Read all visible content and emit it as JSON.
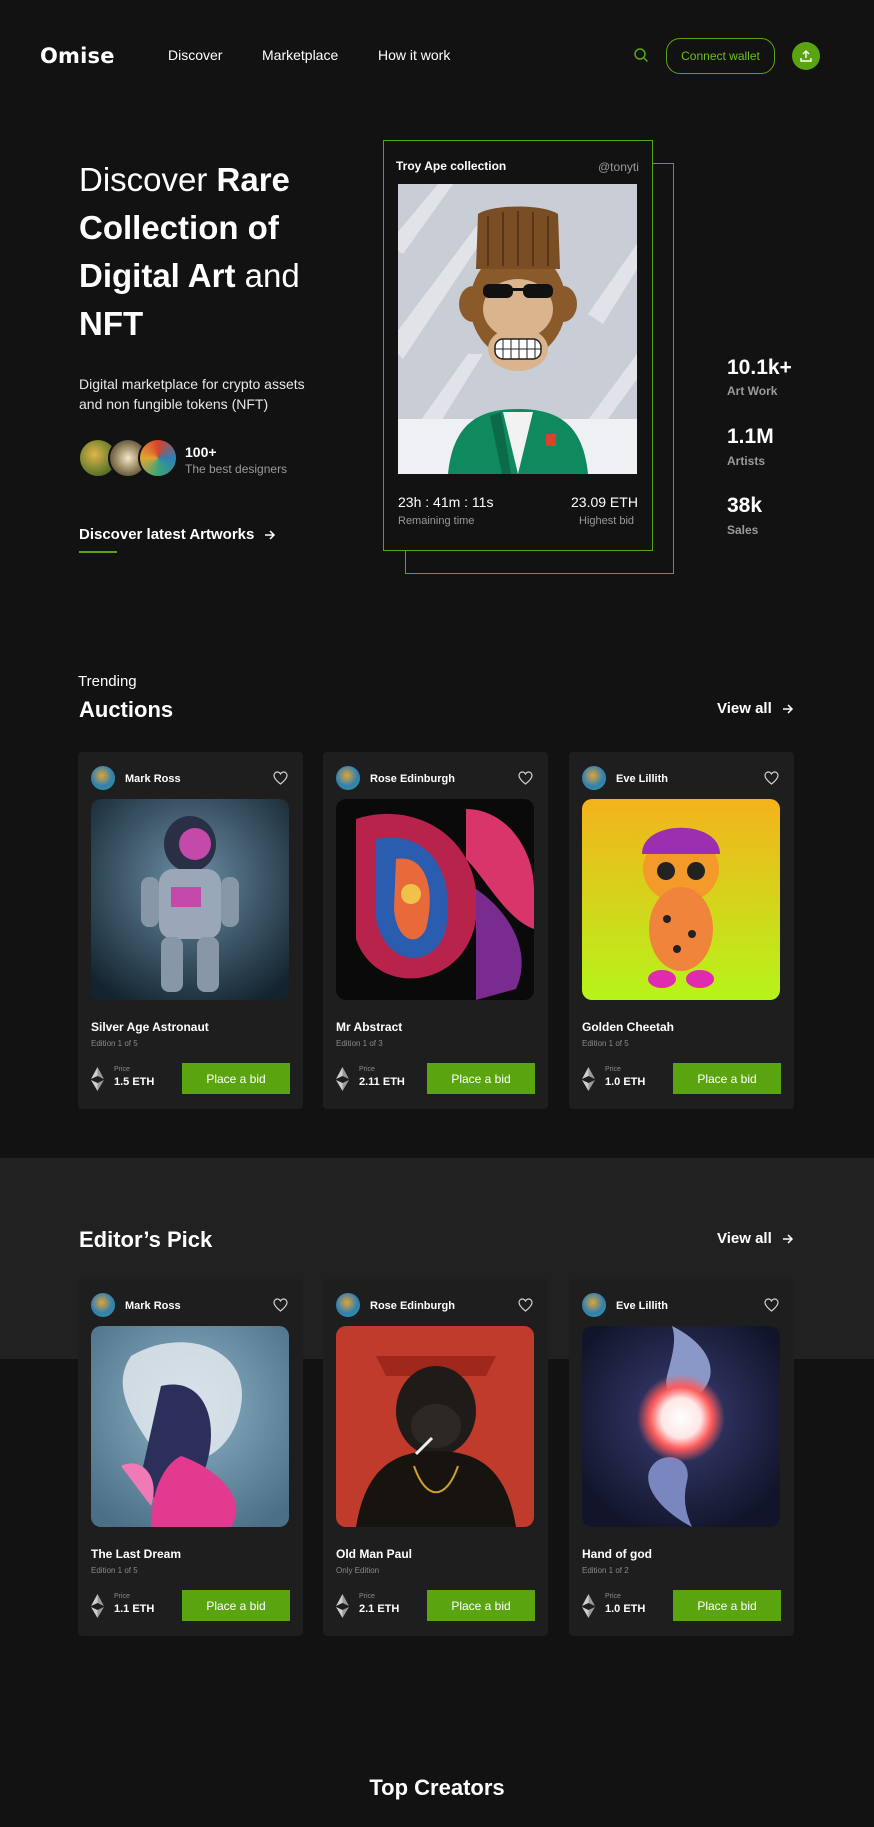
{
  "nav": {
    "logo": "Omise",
    "links": [
      "Discover",
      "Marketplace",
      "How it work"
    ],
    "connect_label": "Connect wallet"
  },
  "hero": {
    "title_parts": [
      "Discover ",
      "Rare Collection of Digital Art",
      " and ",
      "NFT"
    ],
    "subtitle": "Digital marketplace for crypto assets and non fungible tokens (NFT)",
    "designers_count": "100+",
    "designers_label": "The best designers",
    "cta": "Discover latest Artworks",
    "card": {
      "title": "Troy Ape collection",
      "handle": "@tonyti",
      "time": "23h : 41m : 11s",
      "time_label": "Remaining time",
      "bid": "23.09 ETH",
      "bid_label": "Highest bid"
    },
    "stats": [
      {
        "value": "10.1k+",
        "label": "Art Work"
      },
      {
        "value": "1.1M",
        "label": "Artists"
      },
      {
        "value": "38k",
        "label": "Sales"
      }
    ]
  },
  "auctions": {
    "eyebrow": "Trending",
    "title": "Auctions",
    "view_all": "View all",
    "cards": [
      {
        "creator": "Mark Ross",
        "title": "Silver Age Astronaut",
        "edition": "Edition 1 of 5",
        "price_label": "Price",
        "price": "1.5 ETH",
        "bid_label": "Place a bid"
      },
      {
        "creator": "Rose Edinburgh",
        "title": "Mr Abstract",
        "edition": "Edition 1 of 3",
        "price_label": "Price",
        "price": "2.11 ETH",
        "bid_label": "Place a bid"
      },
      {
        "creator": "Eve Lillith",
        "title": "Golden Cheetah",
        "edition": "Edition 1 of 5",
        "price_label": "Price",
        "price": "1.0 ETH",
        "bid_label": "Place a bid"
      }
    ]
  },
  "editors": {
    "title": "Editor’s Pick",
    "view_all": "View all",
    "cards": [
      {
        "creator": "Mark Ross",
        "title": "The Last Dream",
        "edition": "Edition 1 of 5",
        "price_label": "Price",
        "price": "1.1 ETH",
        "bid_label": "Place a bid"
      },
      {
        "creator": "Rose Edinburgh",
        "title": "Old Man Paul",
        "edition": "Only Edition",
        "price_label": "Price",
        "price": "2.1 ETH",
        "bid_label": "Place a bid"
      },
      {
        "creator": "Eve Lillith",
        "title": "Hand of god",
        "edition": "Edition 1 of 2",
        "price_label": "Price",
        "price": "1.0 ETH",
        "bid_label": "Place a bid"
      }
    ]
  },
  "top_creators": "Top Creators",
  "colors": {
    "accent": "#5aa50f",
    "background": "#121212",
    "card": "#1e1e1e",
    "band": "#212121"
  }
}
